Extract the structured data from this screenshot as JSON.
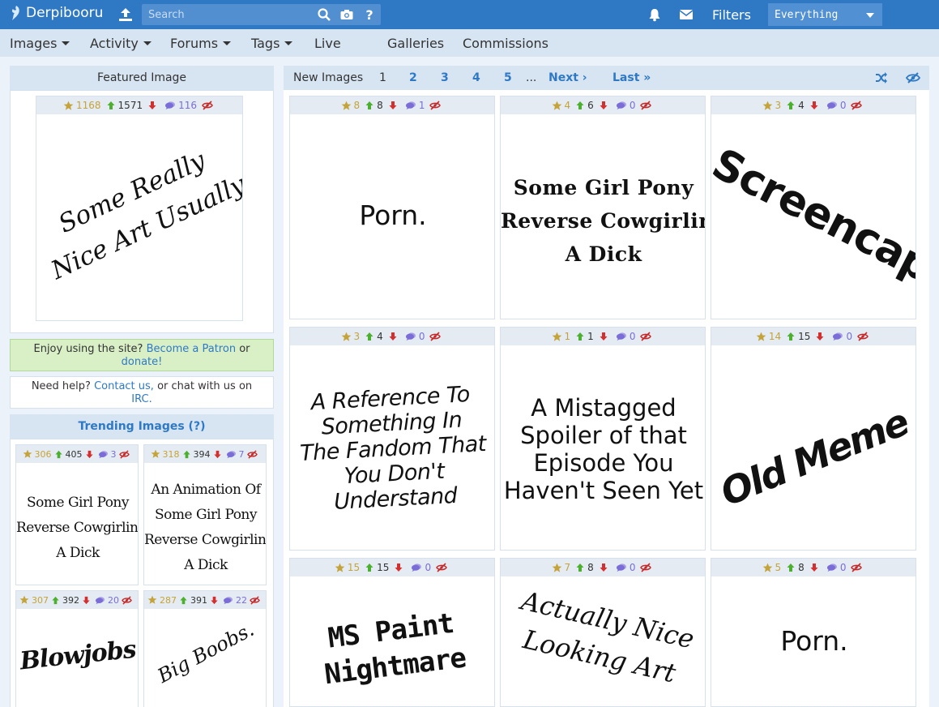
{
  "header": {
    "site_name": "Derpibooru",
    "search_placeholder": "Search",
    "filters_label": "Filters",
    "filter_value": "Everything"
  },
  "nav": {
    "images": "Images",
    "activity": "Activity",
    "forums": "Forums",
    "tags": "Tags",
    "live": "Live",
    "galleries": "Galleries",
    "commissions": "Commissions"
  },
  "featured": {
    "title": "Featured Image",
    "faves": "1168",
    "score": "1571",
    "comments": "116",
    "caption_lines": [
      "Some Really",
      "Nice Art Usually"
    ]
  },
  "patron": {
    "text": "Enjoy using the site?",
    "link": "Become a Patron",
    "or": "or",
    "donate": "donate!"
  },
  "help": {
    "text": "Need help?",
    "contact": "Contact us,",
    "chat": "or chat with us on",
    "irc": "IRC."
  },
  "trending": {
    "title": "Trending Images (?)",
    "items": [
      {
        "faves": "306",
        "score": "405",
        "comments": "3",
        "caption": [
          "Some Girl Pony",
          "Reverse Cowgirling",
          "A Dick"
        ]
      },
      {
        "faves": "318",
        "score": "394",
        "comments": "7",
        "caption": [
          "An Animation Of",
          "Some Girl Pony",
          "Reverse Cowgirling",
          "A Dick"
        ]
      },
      {
        "faves": "307",
        "score": "392",
        "comments": "20",
        "caption": [
          "Blowjobs"
        ]
      },
      {
        "faves": "287",
        "score": "391",
        "comments": "22",
        "caption": [
          "Big Boobs."
        ]
      }
    ]
  },
  "pagination": {
    "label": "New Images",
    "current": "1",
    "pages": [
      "2",
      "3",
      "4",
      "5"
    ],
    "ellipsis": "...",
    "next": "Next ›",
    "last": "Last »"
  },
  "images": [
    {
      "faves": "8",
      "up": "8",
      "comments": "1",
      "caption": [
        "Porn."
      ]
    },
    {
      "faves": "4",
      "up": "6",
      "comments": "0",
      "caption": [
        "Some Girl Pony",
        "Reverse Cowgirling",
        "A Dick"
      ]
    },
    {
      "faves": "3",
      "up": "4",
      "comments": "0",
      "caption": [
        "Screencap"
      ]
    },
    {
      "faves": "3",
      "up": "4",
      "comments": "0",
      "caption": [
        "A Reference To",
        "Something In",
        "The Fandom That",
        "You Don't",
        "Understand"
      ]
    },
    {
      "faves": "1",
      "up": "1",
      "comments": "0",
      "caption": [
        "A Mistagged",
        "Spoiler of that",
        "Episode You",
        "Haven't Seen Yet"
      ]
    },
    {
      "faves": "14",
      "up": "15",
      "comments": "0",
      "caption": [
        "Old Meme"
      ]
    },
    {
      "faves": "15",
      "up": "15",
      "comments": "0",
      "caption": [
        "MS Paint",
        "Nightmare"
      ]
    },
    {
      "faves": "7",
      "up": "8",
      "comments": "0",
      "caption": [
        "Actually Nice",
        "Looking Art"
      ]
    },
    {
      "faves": "5",
      "up": "8",
      "comments": "0",
      "caption": [
        "Porn."
      ]
    }
  ],
  "colors": {
    "header_bg": "#2f79c4",
    "nav_bg": "#d7e5f3",
    "page_bg": "#ecf2f9",
    "link": "#2f79c4",
    "fave_star": "#c4a43a",
    "upvote": "#4caf2e",
    "downvote": "#d32f2f",
    "comment": "#7b6dd8",
    "hide": "#c62828"
  }
}
